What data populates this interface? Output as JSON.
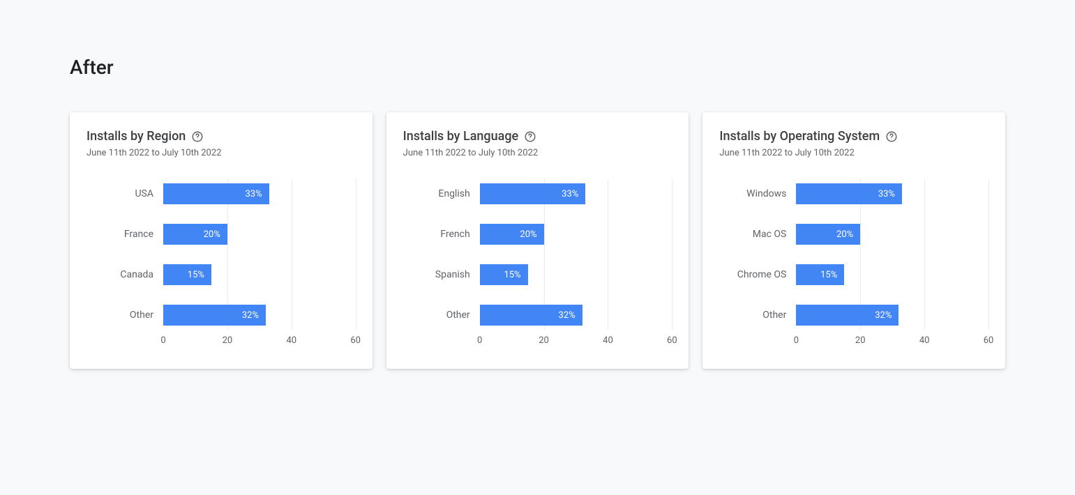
{
  "pageTitle": "After",
  "dateRange": "June 11th 2022 to July 10th 2022",
  "axis": {
    "min": 0,
    "max": 60,
    "ticks": [
      0,
      20,
      40,
      60
    ]
  },
  "cards": [
    {
      "title": "Installs by Region"
    },
    {
      "title": "Installs by Language"
    },
    {
      "title": "Installs by Operating System"
    }
  ],
  "chart_data": [
    {
      "type": "bar",
      "title": "Installs by Region",
      "xlabel": "",
      "ylabel": "",
      "xlim": [
        0,
        60
      ],
      "categories": [
        "USA",
        "France",
        "Canada",
        "Other"
      ],
      "values": [
        33,
        20,
        15,
        32
      ],
      "value_labels": [
        "33%",
        "20%",
        "15%",
        "32%"
      ]
    },
    {
      "type": "bar",
      "title": "Installs by Language",
      "xlabel": "",
      "ylabel": "",
      "xlim": [
        0,
        60
      ],
      "categories": [
        "English",
        "French",
        "Spanish",
        "Other"
      ],
      "values": [
        33,
        20,
        15,
        32
      ],
      "value_labels": [
        "33%",
        "20%",
        "15%",
        "32%"
      ]
    },
    {
      "type": "bar",
      "title": "Installs by Operating System",
      "xlabel": "",
      "ylabel": "",
      "xlim": [
        0,
        60
      ],
      "categories": [
        "Windows",
        "Mac OS",
        "Chrome OS",
        "Other"
      ],
      "values": [
        33,
        20,
        15,
        32
      ],
      "value_labels": [
        "33%",
        "20%",
        "15%",
        "32%"
      ]
    }
  ]
}
